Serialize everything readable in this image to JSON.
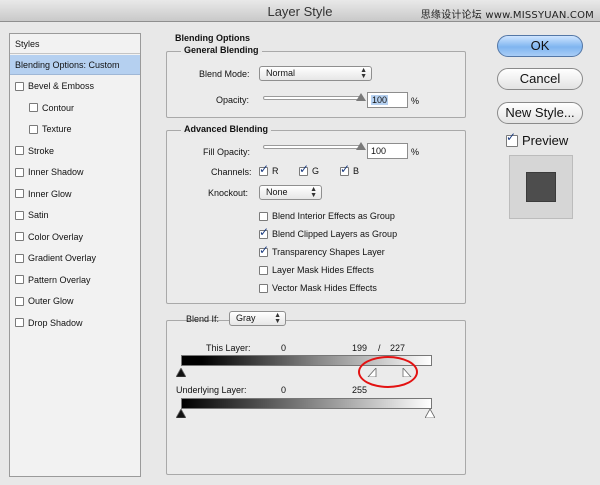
{
  "window": {
    "title": "Layer Style",
    "watermark": "思缘设计论坛 www.MISSYUAN.COM"
  },
  "style_list": {
    "header": "Styles",
    "selected": "Blending Options: Custom",
    "items": [
      {
        "label": "Bevel & Emboss",
        "checked": false,
        "indent": false
      },
      {
        "label": "Contour",
        "checked": false,
        "indent": true
      },
      {
        "label": "Texture",
        "checked": false,
        "indent": true
      },
      {
        "label": "Stroke",
        "checked": false,
        "indent": false
      },
      {
        "label": "Inner Shadow",
        "checked": false,
        "indent": false
      },
      {
        "label": "Inner Glow",
        "checked": false,
        "indent": false
      },
      {
        "label": "Satin",
        "checked": false,
        "indent": false
      },
      {
        "label": "Color Overlay",
        "checked": false,
        "indent": false
      },
      {
        "label": "Gradient Overlay",
        "checked": false,
        "indent": false
      },
      {
        "label": "Pattern Overlay",
        "checked": false,
        "indent": false
      },
      {
        "label": "Outer Glow",
        "checked": false,
        "indent": false
      },
      {
        "label": "Drop Shadow",
        "checked": false,
        "indent": false
      }
    ]
  },
  "blending_options": {
    "title": "Blending Options",
    "general": {
      "title": "General Blending",
      "blend_mode_label": "Blend Mode:",
      "blend_mode_value": "Normal",
      "opacity_label": "Opacity:",
      "opacity_value": "100",
      "opacity_unit": "%",
      "opacity_fraction": 1.0
    },
    "advanced": {
      "title": "Advanced Blending",
      "fill_opacity_label": "Fill Opacity:",
      "fill_opacity_value": "100",
      "fill_opacity_unit": "%",
      "fill_opacity_fraction": 1.0,
      "channels_label": "Channels:",
      "channels": [
        {
          "label": "R",
          "checked": true
        },
        {
          "label": "G",
          "checked": true
        },
        {
          "label": "B",
          "checked": true
        }
      ],
      "knockout_label": "Knockout:",
      "knockout_value": "None",
      "options": [
        {
          "label": "Blend Interior Effects as Group",
          "checked": false
        },
        {
          "label": "Blend Clipped Layers as Group",
          "checked": true
        },
        {
          "label": "Transparency Shapes Layer",
          "checked": true
        },
        {
          "label": "Layer Mask Hides Effects",
          "checked": false
        },
        {
          "label": "Vector Mask Hides Effects",
          "checked": false
        }
      ]
    },
    "blend_if": {
      "label": "Blend If:",
      "value": "Gray",
      "this_layer": {
        "label": "This Layer:",
        "black_value": "0",
        "white_low": "199",
        "separator": "/",
        "white_high": "227"
      },
      "underlying_layer": {
        "label": "Underlying Layer:",
        "black_value": "0",
        "white_value": "255"
      }
    }
  },
  "buttons": {
    "ok": "OK",
    "cancel": "Cancel",
    "new_style": "New Style...",
    "preview_label": "Preview",
    "preview_checked": true
  },
  "colors": {
    "selection": "#b5d0f0",
    "primary_button": "#7fb5f0",
    "annotation_circle": "#e31212"
  }
}
